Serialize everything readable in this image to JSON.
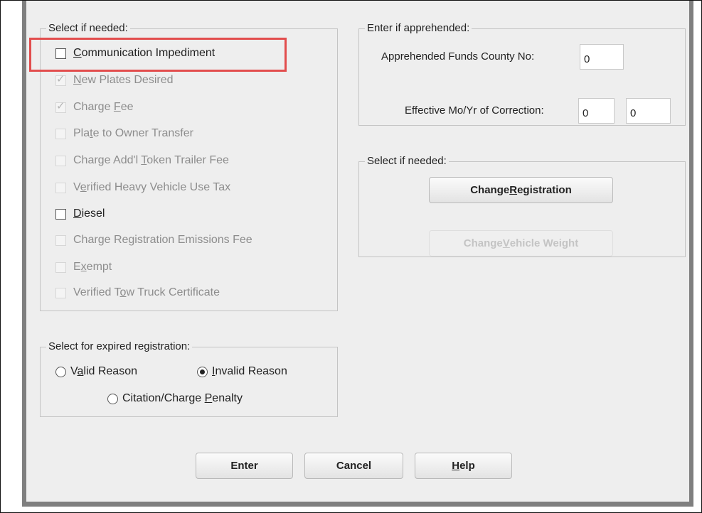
{
  "options_group": {
    "label": "Select if needed:",
    "items": [
      {
        "pre": "",
        "key": "C",
        "post": "ommunication Impediment",
        "checked": false,
        "enabled": true
      },
      {
        "pre": "",
        "key": "N",
        "post": "ew Plates Desired",
        "checked": true,
        "enabled": false
      },
      {
        "pre": "Charge ",
        "key": "F",
        "post": "ee",
        "checked": true,
        "enabled": false
      },
      {
        "pre": "Pla",
        "key": "t",
        "post": "e to Owner Transfer",
        "checked": false,
        "enabled": false
      },
      {
        "pre": "Charge Add'l ",
        "key": "T",
        "post": "oken Trailer Fee",
        "checked": false,
        "enabled": false
      },
      {
        "pre": "V",
        "key": "e",
        "post": "rified Heavy Vehicle Use Tax",
        "checked": false,
        "enabled": false
      },
      {
        "pre": "",
        "key": "D",
        "post": "iesel",
        "checked": false,
        "enabled": true
      },
      {
        "pre": "Char",
        "key": "g",
        "post": "e Registration Emissions Fee",
        "checked": false,
        "enabled": false
      },
      {
        "pre": "E",
        "key": "x",
        "post": "empt",
        "checked": false,
        "enabled": false
      },
      {
        "pre": "Verified T",
        "key": "o",
        "post": "w Truck Certificate",
        "checked": false,
        "enabled": false
      }
    ]
  },
  "apprehended_group": {
    "label": "Enter if apprehended:",
    "county_label": "Apprehended Funds County No:",
    "county_value": "0",
    "effective_label": "Effective Mo/Yr of Correction:",
    "effective_month": "0",
    "effective_year": "0"
  },
  "actions_group": {
    "label": "Select if needed:",
    "change_registration": {
      "pre": "Change ",
      "key": "R",
      "post": "egistration"
    },
    "change_weight": {
      "pre": "Change ",
      "key": "V",
      "post": "ehicle Weight"
    }
  },
  "expired_group": {
    "label": "Select for expired registration:",
    "valid": {
      "pre": "V",
      "key": "a",
      "post": "lid Reason",
      "selected": false
    },
    "invalid": {
      "pre": "",
      "key": "I",
      "post": "nvalid Reason",
      "selected": true
    },
    "citation": {
      "pre": "Citation/Charge ",
      "key": "P",
      "post": "enalty",
      "selected": false
    }
  },
  "buttons": {
    "enter": "Enter",
    "cancel": "Cancel",
    "help": {
      "pre": "",
      "key": "H",
      "post": "elp"
    }
  },
  "colors": {
    "highlight": "#e24d4d",
    "background": "#eeeeee",
    "disabled_text": "#8d8d8d"
  }
}
